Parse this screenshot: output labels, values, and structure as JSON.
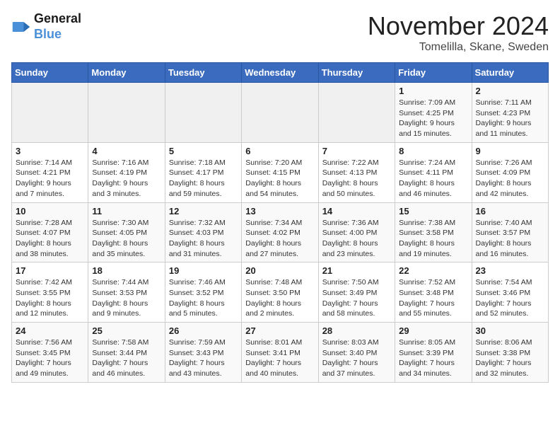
{
  "header": {
    "logo_line1": "General",
    "logo_line2": "Blue",
    "month_title": "November 2024",
    "location": "Tomelilla, Skane, Sweden"
  },
  "weekdays": [
    "Sunday",
    "Monday",
    "Tuesday",
    "Wednesday",
    "Thursday",
    "Friday",
    "Saturday"
  ],
  "weeks": [
    [
      {
        "day": "",
        "info": ""
      },
      {
        "day": "",
        "info": ""
      },
      {
        "day": "",
        "info": ""
      },
      {
        "day": "",
        "info": ""
      },
      {
        "day": "",
        "info": ""
      },
      {
        "day": "1",
        "info": "Sunrise: 7:09 AM\nSunset: 4:25 PM\nDaylight: 9 hours and 15 minutes."
      },
      {
        "day": "2",
        "info": "Sunrise: 7:11 AM\nSunset: 4:23 PM\nDaylight: 9 hours and 11 minutes."
      }
    ],
    [
      {
        "day": "3",
        "info": "Sunrise: 7:14 AM\nSunset: 4:21 PM\nDaylight: 9 hours and 7 minutes."
      },
      {
        "day": "4",
        "info": "Sunrise: 7:16 AM\nSunset: 4:19 PM\nDaylight: 9 hours and 3 minutes."
      },
      {
        "day": "5",
        "info": "Sunrise: 7:18 AM\nSunset: 4:17 PM\nDaylight: 8 hours and 59 minutes."
      },
      {
        "day": "6",
        "info": "Sunrise: 7:20 AM\nSunset: 4:15 PM\nDaylight: 8 hours and 54 minutes."
      },
      {
        "day": "7",
        "info": "Sunrise: 7:22 AM\nSunset: 4:13 PM\nDaylight: 8 hours and 50 minutes."
      },
      {
        "day": "8",
        "info": "Sunrise: 7:24 AM\nSunset: 4:11 PM\nDaylight: 8 hours and 46 minutes."
      },
      {
        "day": "9",
        "info": "Sunrise: 7:26 AM\nSunset: 4:09 PM\nDaylight: 8 hours and 42 minutes."
      }
    ],
    [
      {
        "day": "10",
        "info": "Sunrise: 7:28 AM\nSunset: 4:07 PM\nDaylight: 8 hours and 38 minutes."
      },
      {
        "day": "11",
        "info": "Sunrise: 7:30 AM\nSunset: 4:05 PM\nDaylight: 8 hours and 35 minutes."
      },
      {
        "day": "12",
        "info": "Sunrise: 7:32 AM\nSunset: 4:03 PM\nDaylight: 8 hours and 31 minutes."
      },
      {
        "day": "13",
        "info": "Sunrise: 7:34 AM\nSunset: 4:02 PM\nDaylight: 8 hours and 27 minutes."
      },
      {
        "day": "14",
        "info": "Sunrise: 7:36 AM\nSunset: 4:00 PM\nDaylight: 8 hours and 23 minutes."
      },
      {
        "day": "15",
        "info": "Sunrise: 7:38 AM\nSunset: 3:58 PM\nDaylight: 8 hours and 19 minutes."
      },
      {
        "day": "16",
        "info": "Sunrise: 7:40 AM\nSunset: 3:57 PM\nDaylight: 8 hours and 16 minutes."
      }
    ],
    [
      {
        "day": "17",
        "info": "Sunrise: 7:42 AM\nSunset: 3:55 PM\nDaylight: 8 hours and 12 minutes."
      },
      {
        "day": "18",
        "info": "Sunrise: 7:44 AM\nSunset: 3:53 PM\nDaylight: 8 hours and 9 minutes."
      },
      {
        "day": "19",
        "info": "Sunrise: 7:46 AM\nSunset: 3:52 PM\nDaylight: 8 hours and 5 minutes."
      },
      {
        "day": "20",
        "info": "Sunrise: 7:48 AM\nSunset: 3:50 PM\nDaylight: 8 hours and 2 minutes."
      },
      {
        "day": "21",
        "info": "Sunrise: 7:50 AM\nSunset: 3:49 PM\nDaylight: 7 hours and 58 minutes."
      },
      {
        "day": "22",
        "info": "Sunrise: 7:52 AM\nSunset: 3:48 PM\nDaylight: 7 hours and 55 minutes."
      },
      {
        "day": "23",
        "info": "Sunrise: 7:54 AM\nSunset: 3:46 PM\nDaylight: 7 hours and 52 minutes."
      }
    ],
    [
      {
        "day": "24",
        "info": "Sunrise: 7:56 AM\nSunset: 3:45 PM\nDaylight: 7 hours and 49 minutes."
      },
      {
        "day": "25",
        "info": "Sunrise: 7:58 AM\nSunset: 3:44 PM\nDaylight: 7 hours and 46 minutes."
      },
      {
        "day": "26",
        "info": "Sunrise: 7:59 AM\nSunset: 3:43 PM\nDaylight: 7 hours and 43 minutes."
      },
      {
        "day": "27",
        "info": "Sunrise: 8:01 AM\nSunset: 3:41 PM\nDaylight: 7 hours and 40 minutes."
      },
      {
        "day": "28",
        "info": "Sunrise: 8:03 AM\nSunset: 3:40 PM\nDaylight: 7 hours and 37 minutes."
      },
      {
        "day": "29",
        "info": "Sunrise: 8:05 AM\nSunset: 3:39 PM\nDaylight: 7 hours and 34 minutes."
      },
      {
        "day": "30",
        "info": "Sunrise: 8:06 AM\nSunset: 3:38 PM\nDaylight: 7 hours and 32 minutes."
      }
    ]
  ]
}
